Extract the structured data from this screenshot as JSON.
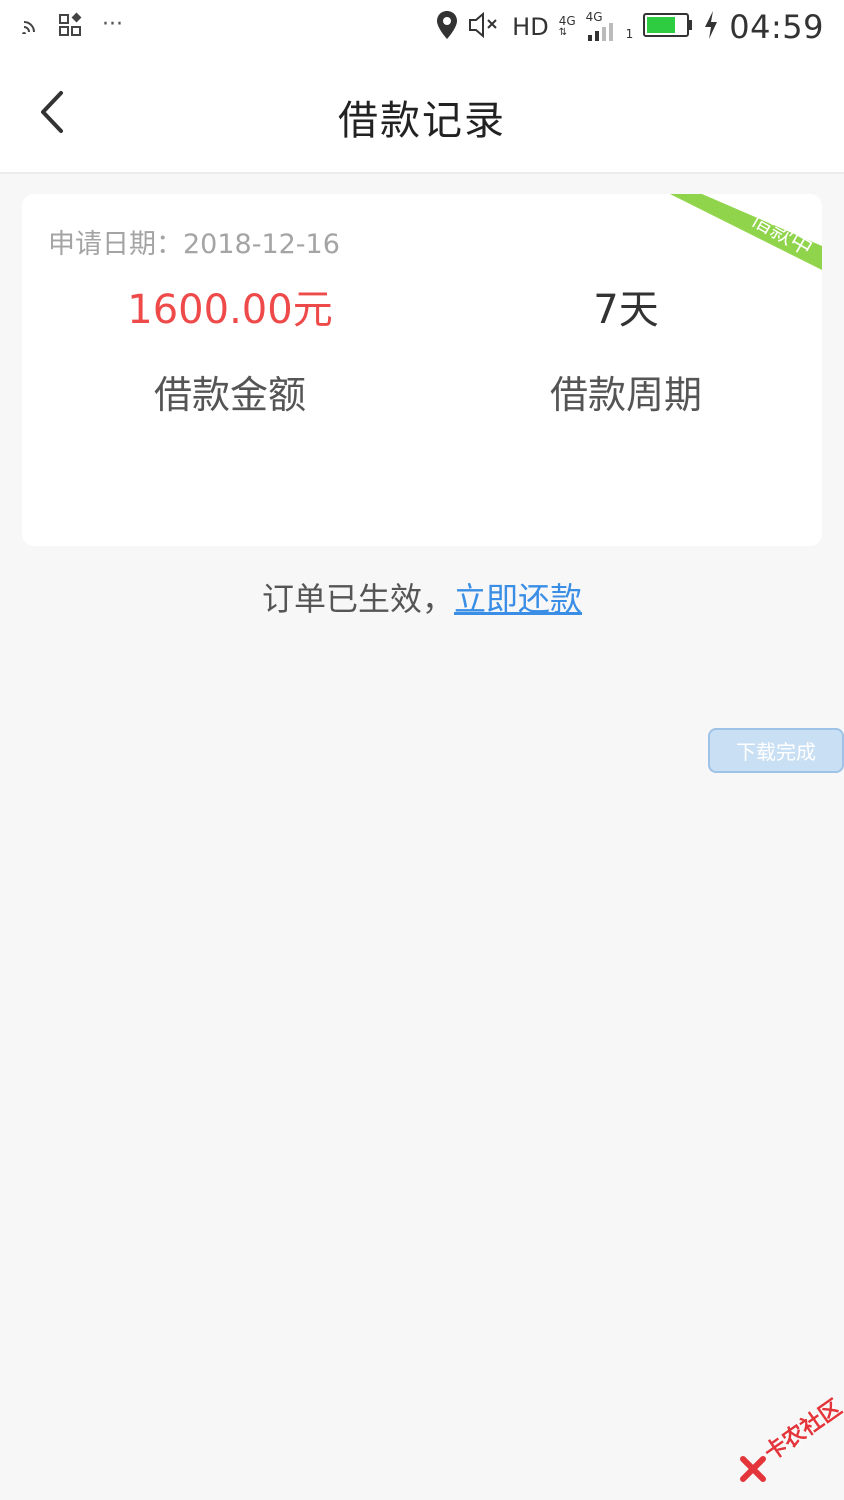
{
  "status_bar": {
    "hd_label": "HD",
    "net_top": "4G",
    "net_bottom": "4G",
    "sim_index": "1",
    "time": "04:59",
    "dots": "···"
  },
  "nav": {
    "title": "借款记录"
  },
  "loan_card": {
    "apply_date": "申请日期：2018-12-16",
    "status_ribbon": "借款中",
    "ribbon_color": "#8fd44a",
    "amount_value": "1600.00元",
    "amount_label": "借款金额",
    "period_value": "7天",
    "period_label": "借款周期"
  },
  "order_message": {
    "prefix": "订单已生效，",
    "link": "立即还款"
  },
  "toast": {
    "text": "下载完成"
  },
  "watermark": {
    "text": "卡农社区"
  },
  "colors": {
    "amount_red": "#ef4a4a",
    "link_blue": "#3a8ee6",
    "battery_green": "#2ecc40"
  }
}
